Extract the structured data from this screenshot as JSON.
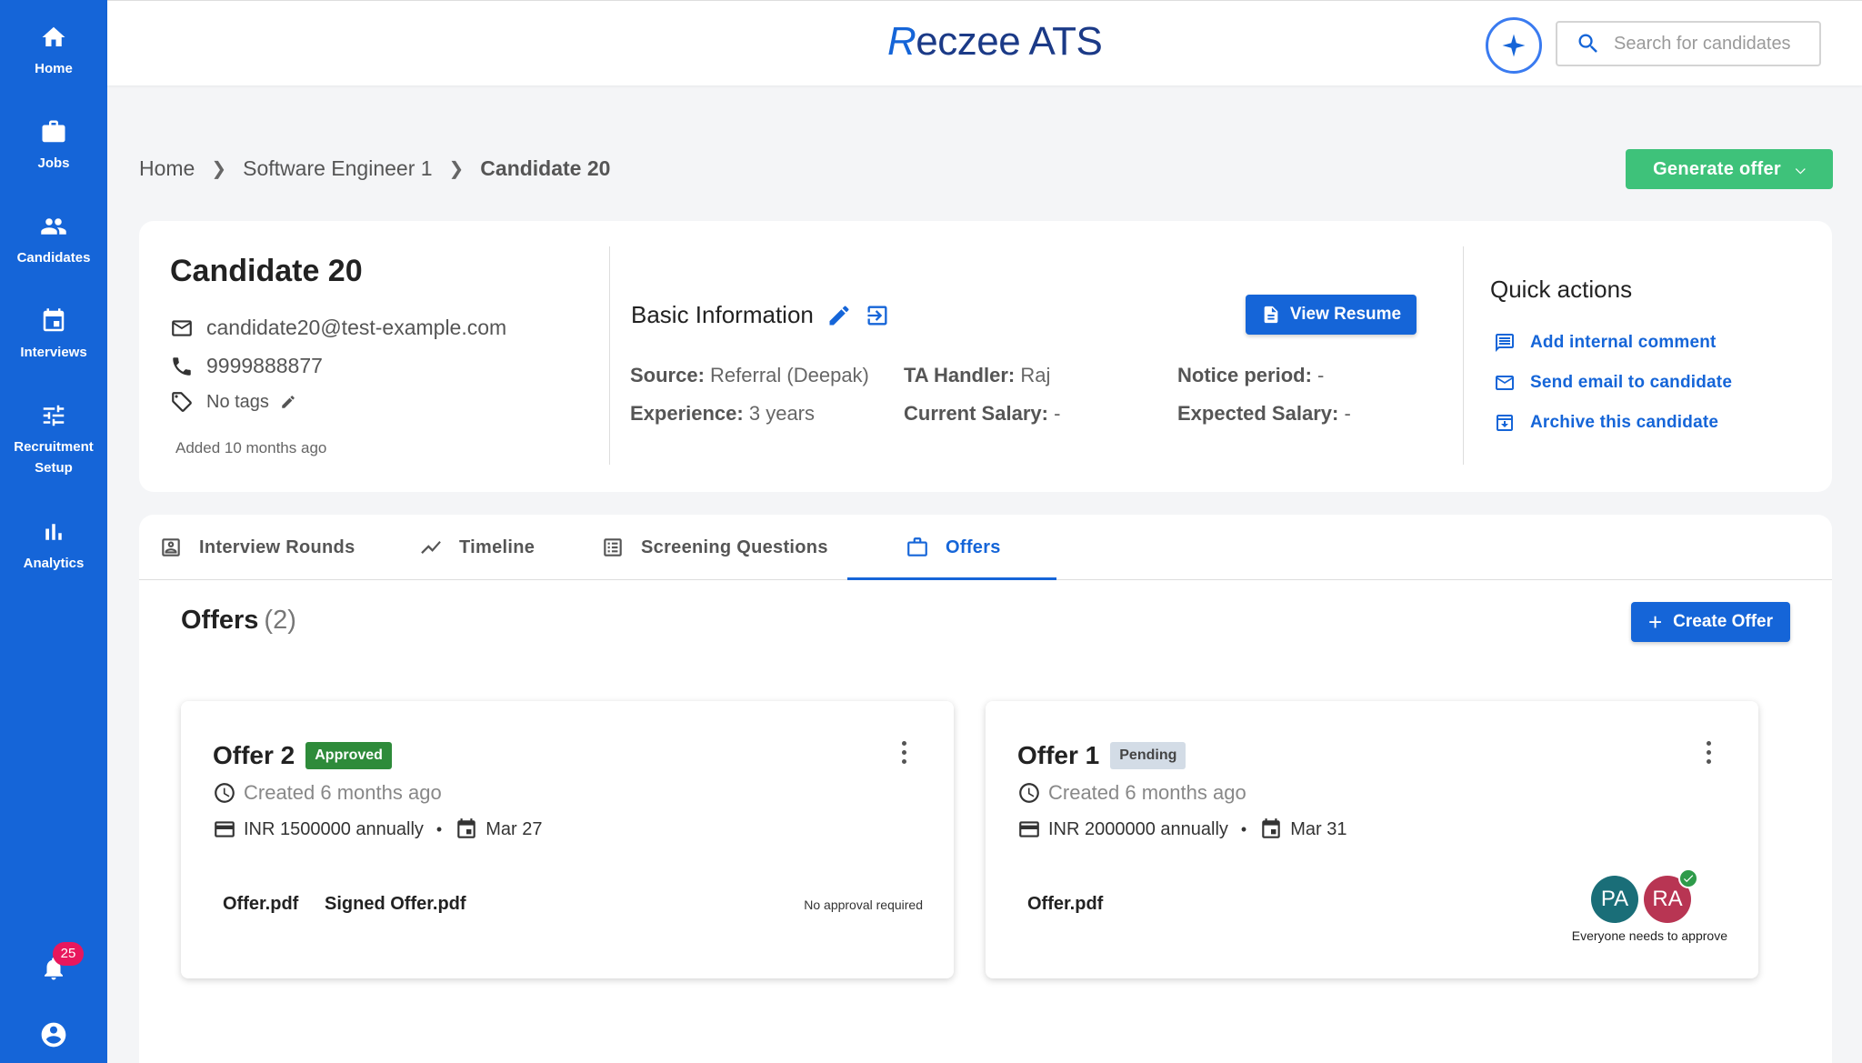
{
  "app": {
    "logo_r": "R",
    "logo_rest": "eczee ATS"
  },
  "colors": {
    "primary": "#1565d8",
    "success": "#3ec27a",
    "approved": "#2e8b3a",
    "notification": "#e8175d"
  },
  "sidebar": {
    "items": [
      {
        "label": "Home",
        "icon": "home-icon"
      },
      {
        "label": "Jobs",
        "icon": "briefcase-icon"
      },
      {
        "label": "Candidates",
        "icon": "people-icon"
      },
      {
        "label": "Interviews",
        "icon": "calendar-icon"
      },
      {
        "label": "Recruitment",
        "label2": "Setup",
        "icon": "tune-icon"
      },
      {
        "label": "Analytics",
        "icon": "bar-chart-icon"
      }
    ],
    "notification_count": "25"
  },
  "header": {
    "search_placeholder": "Search for candidates"
  },
  "breadcrumb": {
    "items": [
      "Home",
      "Software Engineer 1",
      "Candidate 20"
    ]
  },
  "generate_offer": {
    "label": "Generate offer"
  },
  "candidate": {
    "name": "Candidate 20",
    "email": "candidate20@test-example.com",
    "phone": "9999888877",
    "tags": "No tags",
    "added": "Added 10 months ago"
  },
  "basic_info": {
    "title": "Basic Information",
    "view_resume": "View Resume",
    "fields": [
      {
        "label": "Source:",
        "value": "Referral (Deepak)"
      },
      {
        "label": "TA Handler:",
        "value": "Raj"
      },
      {
        "label": "Notice period:",
        "value": "-"
      },
      {
        "label": "Experience:",
        "value": "3 years"
      },
      {
        "label": "Current Salary:",
        "value": "-"
      },
      {
        "label": "Expected Salary:",
        "value": "-"
      }
    ]
  },
  "quick_actions": {
    "title": "Quick actions",
    "items": [
      "Add internal comment",
      "Send email to candidate",
      "Archive this candidate"
    ]
  },
  "tabs": {
    "items": [
      "Interview Rounds",
      "Timeline",
      "Screening Questions",
      "Offers"
    ],
    "active": "Offers"
  },
  "offers": {
    "title": "Offers",
    "count": "(2)",
    "create_label": "Create Offer",
    "cards": [
      {
        "title": "Offer 2",
        "status": "Approved",
        "created": "Created 6 months ago",
        "salary": "INR 1500000 annually",
        "date": "Mar 27",
        "files": [
          "Offer.pdf",
          "Signed Offer.pdf"
        ],
        "approval_note": "No approval required"
      },
      {
        "title": "Offer 1",
        "status": "Pending",
        "created": "Created 6 months ago",
        "salary": "INR 2000000 annually",
        "date": "Mar 31",
        "files": [
          "Offer.pdf"
        ],
        "approvers": [
          {
            "initials": "PA",
            "color": "#1a6e78"
          },
          {
            "initials": "RA",
            "color": "#b83553"
          }
        ],
        "approval_note": "Everyone needs to approve"
      }
    ]
  }
}
